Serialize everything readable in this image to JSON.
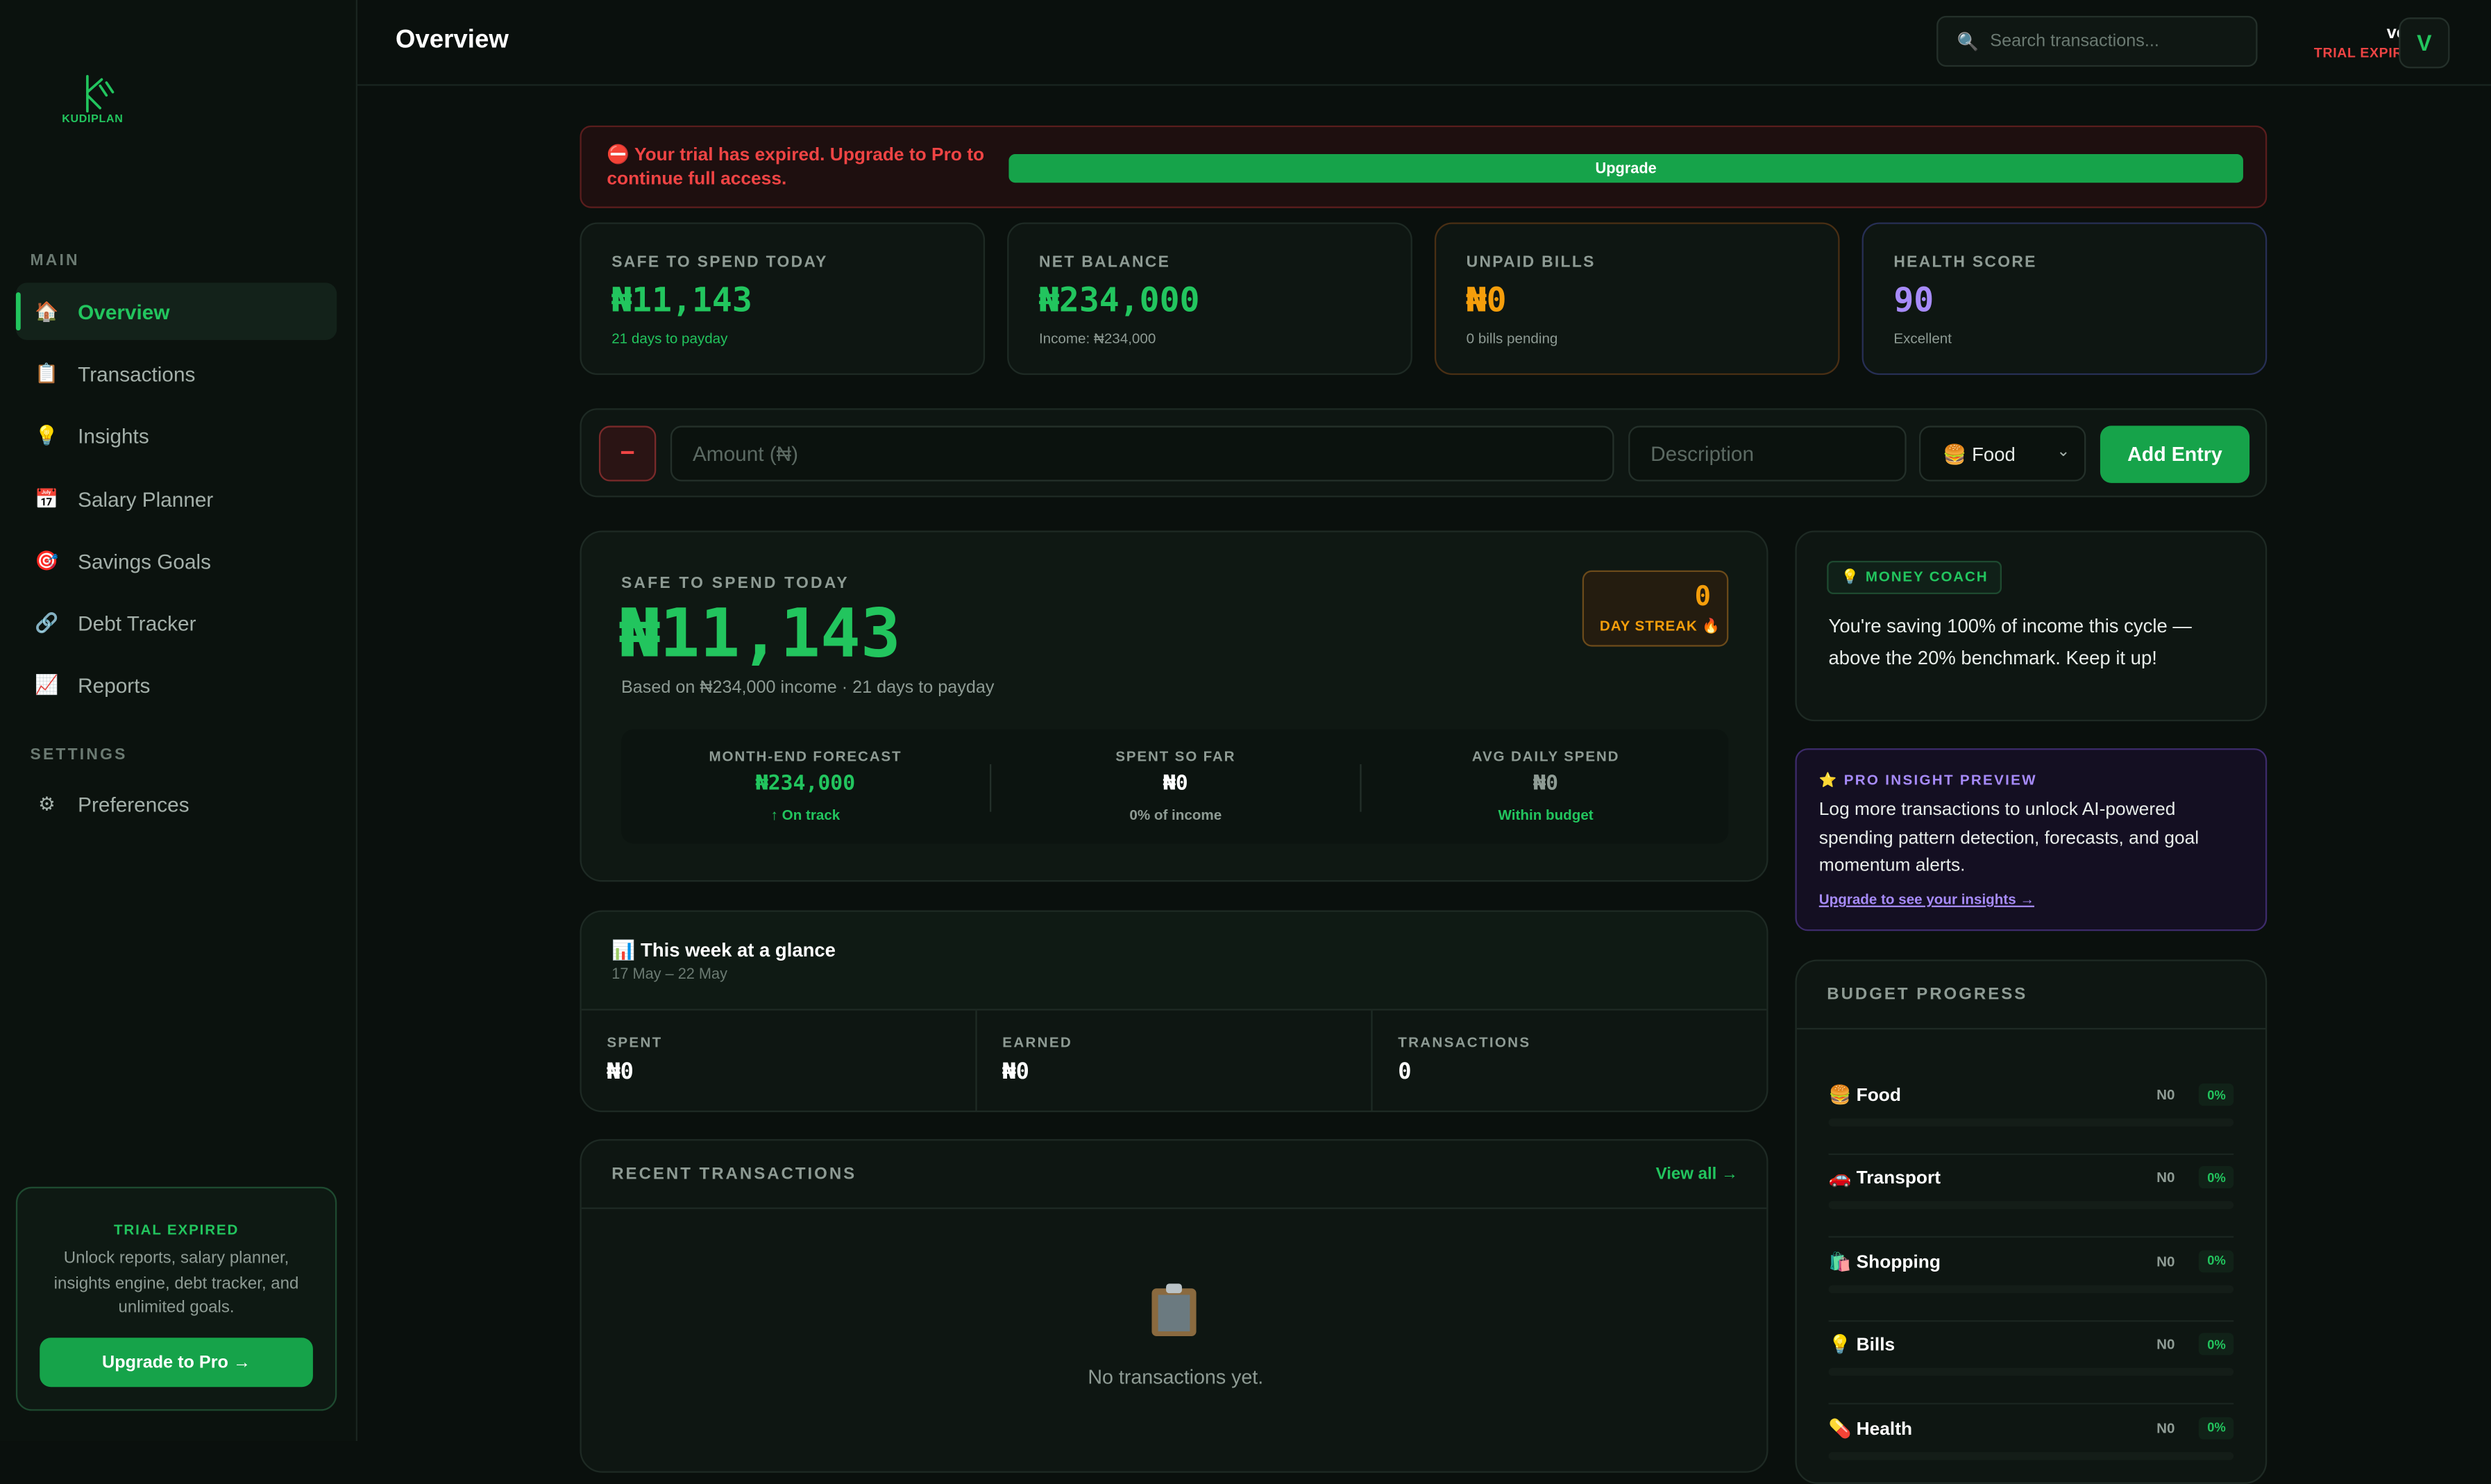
{
  "brand": {
    "name": "KUDIPLAN",
    "accent": "#22c55e"
  },
  "sidebar": {
    "main_label": "MAIN",
    "items": [
      {
        "label": "Overview",
        "icon": "house-icon",
        "active": true
      },
      {
        "label": "Transactions",
        "icon": "clipboard-icon"
      },
      {
        "label": "Insights",
        "icon": "lightbulb-icon"
      },
      {
        "label": "Salary Planner",
        "icon": "calendar-icon"
      },
      {
        "label": "Savings Goals",
        "icon": "target-icon"
      },
      {
        "label": "Debt Tracker",
        "icon": "link-icon"
      },
      {
        "label": "Reports",
        "icon": "chart-icon"
      }
    ],
    "settings_label": "SETTINGS",
    "settings_items": [
      {
        "label": "Preferences",
        "icon": "gear-icon"
      }
    ],
    "trial_card": {
      "title": "TRIAL EXPIRED",
      "description": "Unlock reports, salary planner, insights engine, debt tracker, and unlimited goals.",
      "button": "Upgrade to Pro →"
    }
  },
  "header": {
    "title": "Overview",
    "search_placeholder": "Search transactions...",
    "user_name": "vera",
    "user_status": "TRIAL EXPIRED",
    "avatar_initial": "V"
  },
  "banner": {
    "message": "⛔ Your trial has expired. Upgrade to Pro to continue full access.",
    "button": "Upgrade"
  },
  "stats": [
    {
      "label": "SAFE TO SPEND TODAY",
      "value": "₦11,143",
      "sub": "21 days to payday",
      "color": "#22c55e",
      "sub_color": "#22c55e",
      "border": "#1e2a24"
    },
    {
      "label": "NET BALANCE",
      "value": "₦234,000",
      "sub": "Income: ₦234,000",
      "color": "#22c55e",
      "sub_color": "#8e9b94",
      "border": "#1e2a24"
    },
    {
      "label": "UNPAID BILLS",
      "value": "₦0",
      "sub": "0 bills pending",
      "color": "#f59e0b",
      "sub_color": "#8e9b94",
      "border": "#4a2f14"
    },
    {
      "label": "HEALTH SCORE",
      "value": "90",
      "sub": "Excellent",
      "color": "#a78bfa",
      "sub_color": "#8e9b94",
      "border": "#272f55"
    }
  ],
  "entry": {
    "minus_label": "−",
    "amount_placeholder": "Amount (₦)",
    "description_placeholder": "Description",
    "category_selected": "🍔 Food",
    "add_button": "Add Entry"
  },
  "safe_card": {
    "label": "SAFE TO SPEND TODAY",
    "amount": "₦11,143",
    "note": "Based on ₦234,000 income · 21 days to payday",
    "streak_value": "0",
    "streak_label": "DAY STREAK 🔥",
    "forecast": [
      {
        "label": "MONTH-END FORECAST",
        "value": "₦234,000",
        "status": "↑ On track",
        "value_color": "#22c55e",
        "status_color": "#22c55e"
      },
      {
        "label": "SPENT SO FAR",
        "value": "₦0",
        "status": "0% of income",
        "value_color": "#ffffff",
        "status_color": "#8e9b94"
      },
      {
        "label": "AVG DAILY SPEND",
        "value": "₦0",
        "status": "Within budget",
        "value_color": "#8e9b94",
        "status_color": "#22c55e"
      }
    ]
  },
  "week": {
    "title": "📊 This week at a glance",
    "range": "17 May – 22 May",
    "cells": [
      {
        "label": "SPENT",
        "value": "₦0"
      },
      {
        "label": "EARNED",
        "value": "₦0"
      },
      {
        "label": "TRANSACTIONS",
        "value": "0"
      }
    ]
  },
  "recent": {
    "title": "RECENT TRANSACTIONS",
    "view_all": "View all →",
    "empty": "No transactions yet."
  },
  "coach": {
    "label": "💡 MONEY COACH",
    "text": "You're saving 100% of income this cycle — above the 20% benchmark. Keep it up!"
  },
  "pro_insight": {
    "title": "⭐ PRO INSIGHT PREVIEW",
    "text": "Log more transactions to unlock AI-powered spending pattern detection, forecasts, and goal momentum alerts.",
    "link": "Upgrade to see your insights →"
  },
  "budget": {
    "title": "BUDGET PROGRESS",
    "rows": [
      {
        "name": "🍔 Food",
        "amount": "N0",
        "percent": "0%",
        "progress": 0
      },
      {
        "name": "🚗 Transport",
        "amount": "N0",
        "percent": "0%",
        "progress": 0
      },
      {
        "name": "🛍️ Shopping",
        "amount": "N0",
        "percent": "0%",
        "progress": 0
      },
      {
        "name": "💡 Bills",
        "amount": "N0",
        "percent": "0%",
        "progress": 0
      },
      {
        "name": "💊 Health",
        "amount": "N0",
        "percent": "0%",
        "progress": 0
      }
    ]
  }
}
